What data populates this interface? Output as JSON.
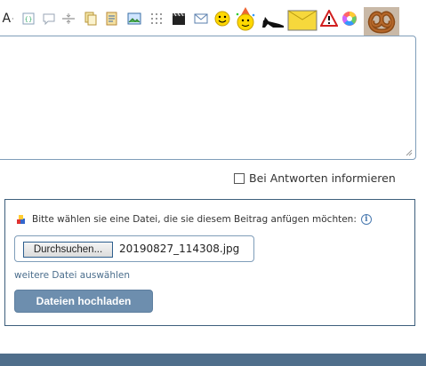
{
  "toolbar": {
    "font_size_label": "A",
    "font_size_suffix": "·",
    "icons": [
      "bbcode-icon",
      "comment-icon",
      "divider-icon",
      "copy-icon",
      "paste-icon",
      "image-icon",
      "grid-icon",
      "video-icon",
      "mail-icon",
      "smiley-icon",
      "party-smiley-icon",
      "high-heel-icon",
      "envelope-icon",
      "warning-icon",
      "color-wheel-icon",
      "pretzel-icon"
    ]
  },
  "editor": {
    "value": ""
  },
  "notify": {
    "label": "Bei Antworten informieren",
    "checked": false
  },
  "attachments": {
    "prompt": "Bitte wählen sie eine Datei, die sie diesem Beitrag anfügen möchten:",
    "browse_label": "Durchsuchen...",
    "file_name": "20190827_114308.jpg",
    "more_files_label": "weitere Datei auswählen",
    "upload_label": "Dateien hochladen"
  },
  "colors": {
    "accent": "#6d8eae",
    "border": "#3e5f7c",
    "bottom_bar": "#4f6e8b"
  }
}
